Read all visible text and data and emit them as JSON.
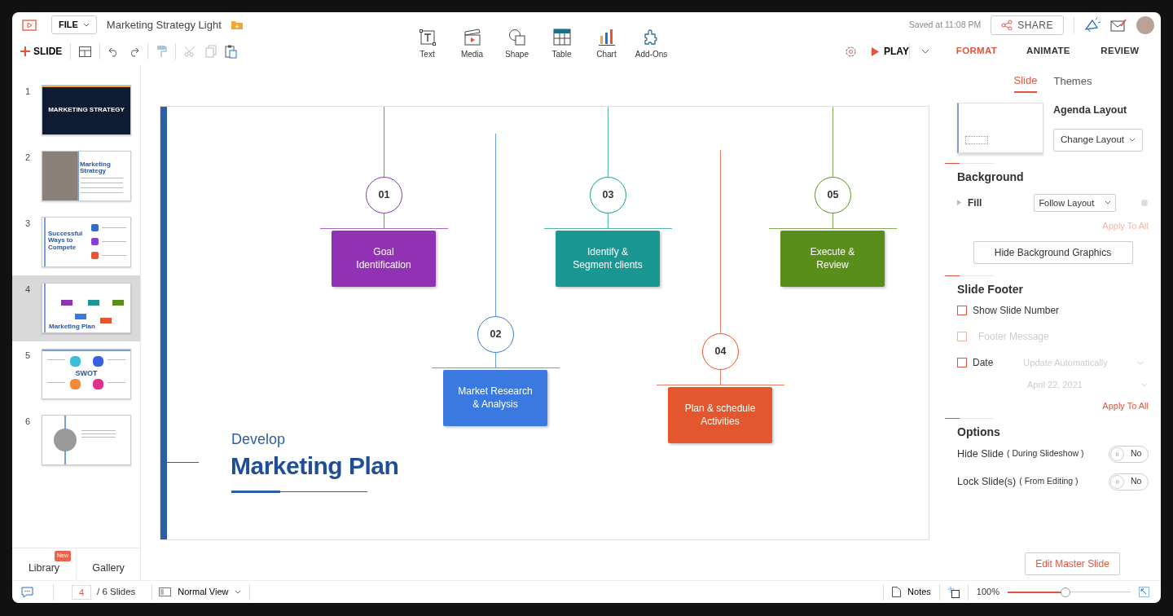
{
  "header": {
    "file_menu": "FILE",
    "doc_title": "Marketing Strategy Light",
    "saved": "Saved at 11:08 PM",
    "share": "SHARE"
  },
  "toolbar": {
    "new_slide": "SLIDE",
    "play": "PLAY"
  },
  "insert_tools": [
    {
      "kind": "text",
      "label": "Text"
    },
    {
      "kind": "media",
      "label": "Media"
    },
    {
      "kind": "shape",
      "label": "Shape"
    },
    {
      "kind": "table",
      "label": "Table"
    },
    {
      "kind": "chart",
      "label": "Chart"
    },
    {
      "kind": "addons",
      "label": "Add-Ons"
    }
  ],
  "ribbon_tabs": [
    {
      "label": "FORMAT",
      "selected": true
    },
    {
      "label": "ANIMATE",
      "selected": false
    },
    {
      "label": "REVIEW",
      "selected": false
    }
  ],
  "thumbnails": [
    {
      "number": "1",
      "kind": "cover",
      "title": "MARKETING STRATEGY",
      "selected": false
    },
    {
      "number": "2",
      "kind": "photo",
      "title": "Marketing Strategy",
      "selected": false
    },
    {
      "number": "3",
      "kind": "list",
      "title": "Successful Ways to Compete",
      "selected": false
    },
    {
      "number": "4",
      "kind": "diagram",
      "title": "Marketing Plan",
      "selected": true
    },
    {
      "number": "5",
      "kind": "swot",
      "title": "SWOT",
      "selected": false
    },
    {
      "number": "6",
      "kind": "profile",
      "selected": false
    }
  ],
  "library_tabs": [
    {
      "label": "Library",
      "badge": "New"
    },
    {
      "label": "Gallery"
    }
  ],
  "slide": {
    "eyebrow": "Develop",
    "title": "Marketing Plan",
    "steps": [
      {
        "number": "01",
        "label": "Goal\nIdentification",
        "color": "#9132b4"
      },
      {
        "number": "02",
        "label": "Market Research\n& Analysis",
        "color": "#3a7ae0"
      },
      {
        "number": "03",
        "label": "Identify &\nSegment clients",
        "color": "#1a9793"
      },
      {
        "number": "04",
        "label": "Plan & schedule\nActivities",
        "color": "#e4572e"
      },
      {
        "number": "05",
        "label": "Execute &\nReview",
        "color": "#5a8e1b"
      }
    ]
  },
  "panel": {
    "tabs": [
      {
        "label": "Slide",
        "selected": true
      },
      {
        "label": "Themes",
        "selected": false
      }
    ],
    "layout_name": "Agenda Layout",
    "change_layout": "Change Layout",
    "background": {
      "title": "Background",
      "fill_label": "Fill",
      "fill_value": "Follow Layout",
      "apply_all": {
        "label": "Apply To All",
        "disabled": true
      },
      "hide_graphics": "Hide Background Graphics"
    },
    "footer": {
      "title": "Slide Footer",
      "options": [
        {
          "label": "Show Slide Number",
          "checked": false,
          "disabled": false
        },
        {
          "label": "Footer Message",
          "checked": false,
          "disabled": true
        },
        {
          "label": "Date",
          "checked": false,
          "disabled": false,
          "selects": [
            {
              "value": "Update Automatically",
              "disabled": true
            },
            {
              "value": "April 22, 2021",
              "disabled": true
            }
          ]
        }
      ],
      "apply_all": {
        "label": "Apply To All",
        "disabled": false
      }
    },
    "options": {
      "title": "Options",
      "toggles": [
        {
          "label": "Hide Slide",
          "note": "( During Slideshow )",
          "on": false,
          "state": "No"
        },
        {
          "label": "Lock Slide(s)",
          "note": "( From Editing )",
          "on": false,
          "state": "No"
        }
      ]
    },
    "edit_master": "Edit Master Slide"
  },
  "status": {
    "page": "4",
    "total": "/ 6 Slides",
    "view": "Normal View",
    "notes": "Notes",
    "zoom": {
      "label": "100%",
      "level": 0.47
    }
  }
}
